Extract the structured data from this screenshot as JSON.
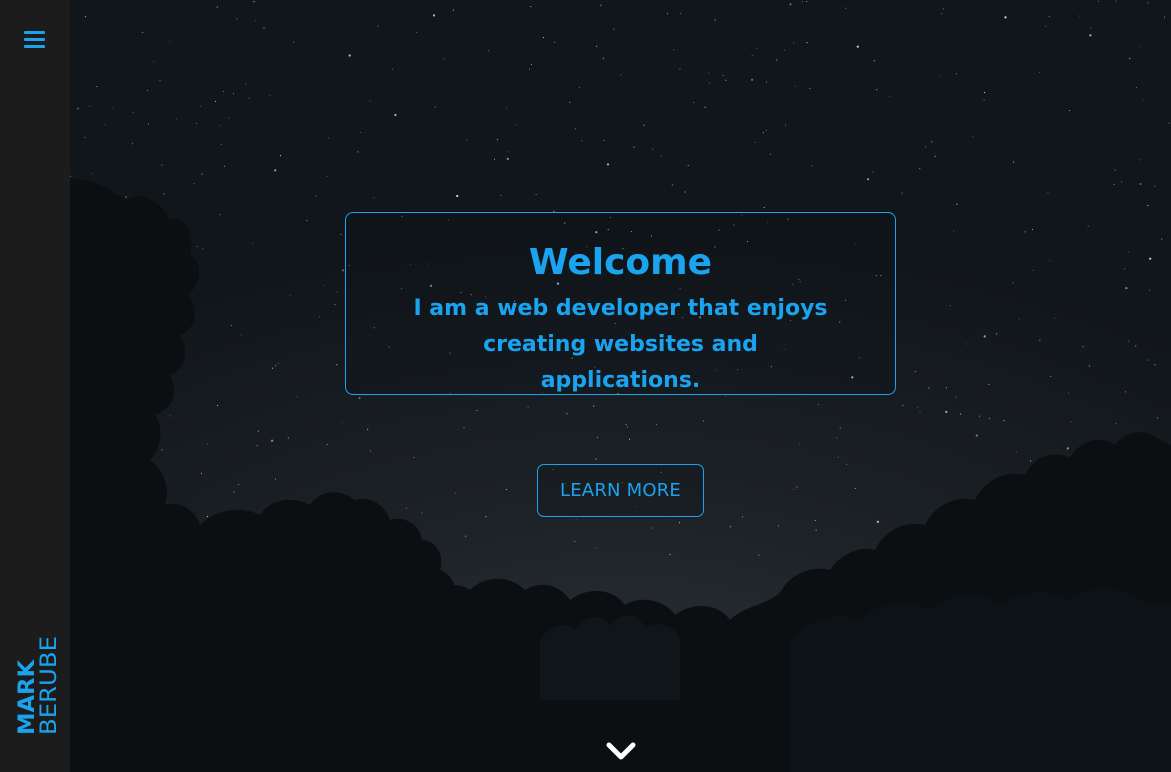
{
  "sidebar": {
    "menu_icon": "hamburger-menu-icon",
    "brand_first": "MARK",
    "brand_last": "BERUBE"
  },
  "hero": {
    "title": "Welcome",
    "subtitle": "I am a web developer that enjoys creating websites and applications.",
    "cta_label": "LEARN MORE",
    "scroll_icon": "chevron-down-icon"
  },
  "colors": {
    "accent": "#1aa3ee",
    "sidebar_bg": "#1c1c1c",
    "hero_bg": "#11161b"
  }
}
